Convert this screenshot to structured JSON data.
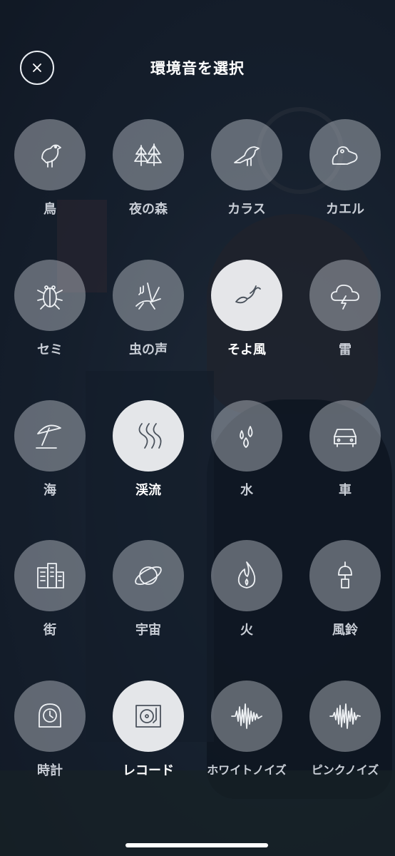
{
  "header": {
    "title": "環境音を選択",
    "close_icon": "close-icon"
  },
  "colors": {
    "tile_default": "#cdd2d8",
    "tile_selected": "#f4f5f7",
    "label_default": "#c9ced6",
    "label_selected": "#ffffff"
  },
  "sounds": [
    {
      "label": "鳥",
      "icon": "bird-icon",
      "selected": false
    },
    {
      "label": "夜の森",
      "icon": "forest-icon",
      "selected": false
    },
    {
      "label": "カラス",
      "icon": "crow-icon",
      "selected": false
    },
    {
      "label": "カエル",
      "icon": "frog-icon",
      "selected": false
    },
    {
      "label": "セミ",
      "icon": "cicada-icon",
      "selected": false
    },
    {
      "label": "虫の声",
      "icon": "cricket-icon",
      "selected": false
    },
    {
      "label": "そよ風",
      "icon": "breeze-icon",
      "selected": true
    },
    {
      "label": "雷",
      "icon": "thunder-icon",
      "selected": false
    },
    {
      "label": "海",
      "icon": "beach-umbrella-icon",
      "selected": false
    },
    {
      "label": "渓流",
      "icon": "stream-icon",
      "selected": true
    },
    {
      "label": "水",
      "icon": "water-drops-icon",
      "selected": false
    },
    {
      "label": "車",
      "icon": "car-icon",
      "selected": false
    },
    {
      "label": "街",
      "icon": "city-buildings-icon",
      "selected": false
    },
    {
      "label": "宇宙",
      "icon": "planet-icon",
      "selected": false
    },
    {
      "label": "火",
      "icon": "fire-icon",
      "selected": false
    },
    {
      "label": "風鈴",
      "icon": "wind-chime-icon",
      "selected": false
    },
    {
      "label": "時計",
      "icon": "clock-icon",
      "selected": false
    },
    {
      "label": "レコード",
      "icon": "record-player-icon",
      "selected": true
    },
    {
      "label": "ホワイトノイズ",
      "icon": "white-noise-wave-icon",
      "selected": false
    },
    {
      "label": "ピンクノイズ",
      "icon": "pink-noise-wave-icon",
      "selected": false
    }
  ]
}
